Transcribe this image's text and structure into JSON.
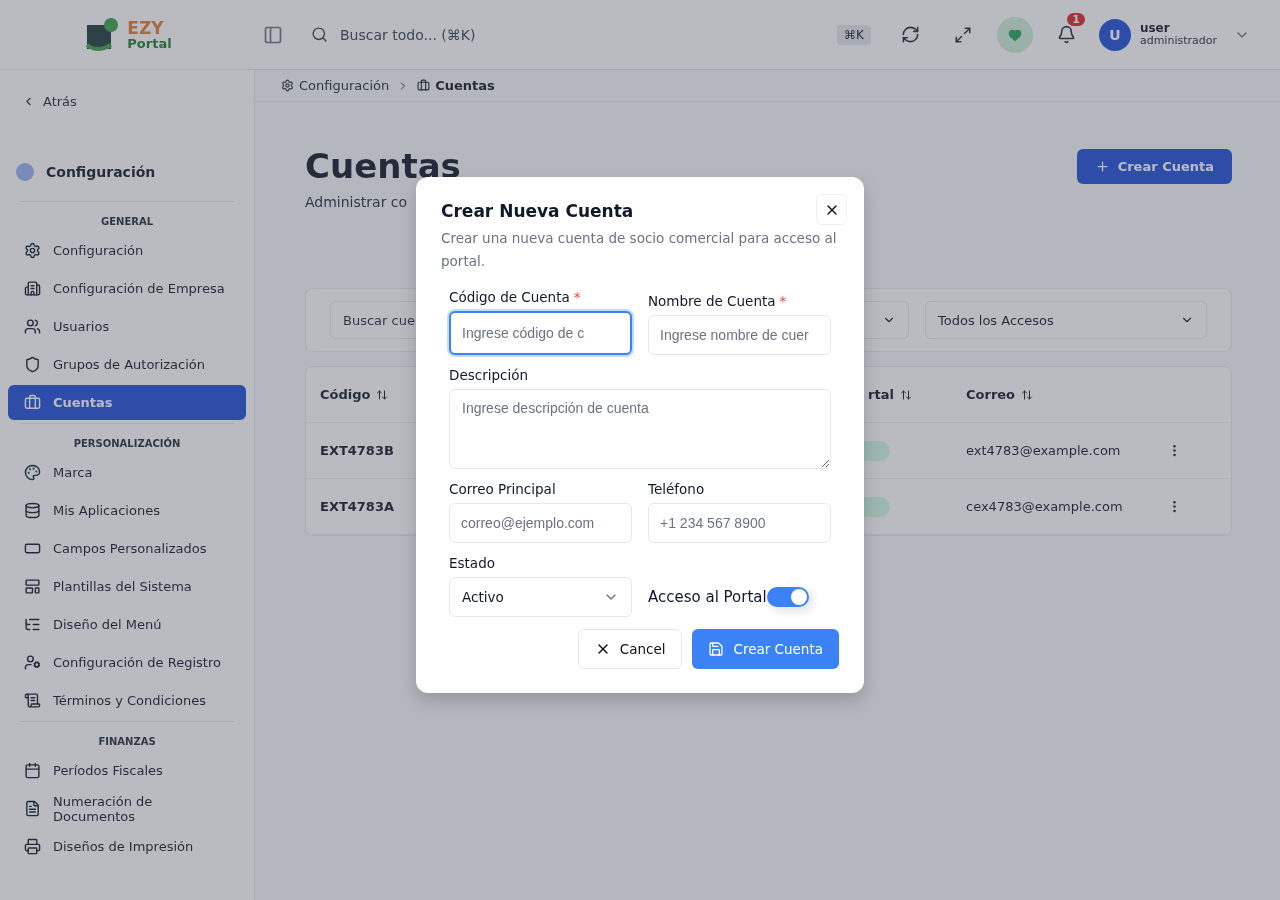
{
  "header": {
    "logo": {
      "word1": "EZY",
      "word2": "Portal"
    },
    "search": {
      "placeholder": "Buscar todo... (⌘K)",
      "shortcut": "⌘K"
    },
    "notifications": {
      "count": "1"
    },
    "user": {
      "initial": "U",
      "name": "user",
      "role": "administrador"
    }
  },
  "sidebar": {
    "back": "Atrás",
    "title": "Configuración",
    "sections": [
      {
        "heading": "GENERAL",
        "items": [
          {
            "label": "Configuración",
            "selected": false
          },
          {
            "label": "Configuración de Empresa",
            "selected": false
          },
          {
            "label": "Usuarios",
            "selected": false
          },
          {
            "label": "Grupos de Autorización",
            "selected": false
          },
          {
            "label": "Cuentas",
            "selected": true
          }
        ]
      },
      {
        "heading": "PERSONALIZACIÓN",
        "items": [
          {
            "label": "Marca",
            "selected": false
          },
          {
            "label": "Mis Aplicaciones",
            "selected": false
          },
          {
            "label": "Campos Personalizados",
            "selected": false
          },
          {
            "label": "Plantillas del Sistema",
            "selected": false
          },
          {
            "label": "Diseño del Menú",
            "selected": false
          },
          {
            "label": "Configuración de Registro",
            "selected": false
          },
          {
            "label": "Términos y Condiciones",
            "selected": false
          }
        ]
      },
      {
        "heading": "FINANZAS",
        "items": [
          {
            "label": "Períodos Fiscales",
            "selected": false
          },
          {
            "label": "Numeración de Documentos",
            "selected": false
          },
          {
            "label": "Diseños de Impresión",
            "selected": false
          }
        ]
      }
    ]
  },
  "breadcrumb": [
    {
      "label": "Configuración"
    },
    {
      "label": "Cuentas"
    }
  ],
  "page": {
    "title": "Cuentas",
    "subtitle": "Administrar co",
    "create_button": "Crear Cuenta"
  },
  "filters": {
    "search_placeholder": "Buscar cue",
    "access_select": "Todos los Accesos"
  },
  "table": {
    "columns": [
      "Código",
      "rtal",
      "Correo"
    ],
    "rows": [
      {
        "code": "EXT4783B",
        "email": "ext4783@example.com"
      },
      {
        "code": "EXT4783A",
        "email": "cex4783@example.com"
      }
    ]
  },
  "dialog": {
    "title": "Crear Nueva Cuenta",
    "description": "Crear una nueva cuenta de socio comercial para acceso al portal.",
    "rows": [
      [
        {
          "kind": "input",
          "label": "Código de Cuenta",
          "required_mark": "*",
          "placeholder": "Ingrese código de c",
          "focused": true
        },
        {
          "kind": "input",
          "label": "Nombre de Cuenta",
          "required_mark": "*",
          "placeholder": "Ingrese nombre de cuer",
          "focused": false
        }
      ],
      [
        {
          "kind": "textarea",
          "label": "Descripción",
          "placeholder": "Ingrese descripción de cuenta"
        }
      ],
      [
        {
          "kind": "input",
          "label": "Correo Principal",
          "placeholder": "correo@ejemplo.com",
          "focused": false
        },
        {
          "kind": "input",
          "label": "Teléfono",
          "placeholder": "+1 234 567 8900",
          "focused": false
        }
      ],
      [
        {
          "kind": "select",
          "label": "Estado",
          "value": "Activo"
        },
        {
          "kind": "switch",
          "label": "Acceso al Portal",
          "on": true
        }
      ]
    ],
    "cancel_button": "Cancel",
    "submit_button": "Crear Cuenta"
  }
}
